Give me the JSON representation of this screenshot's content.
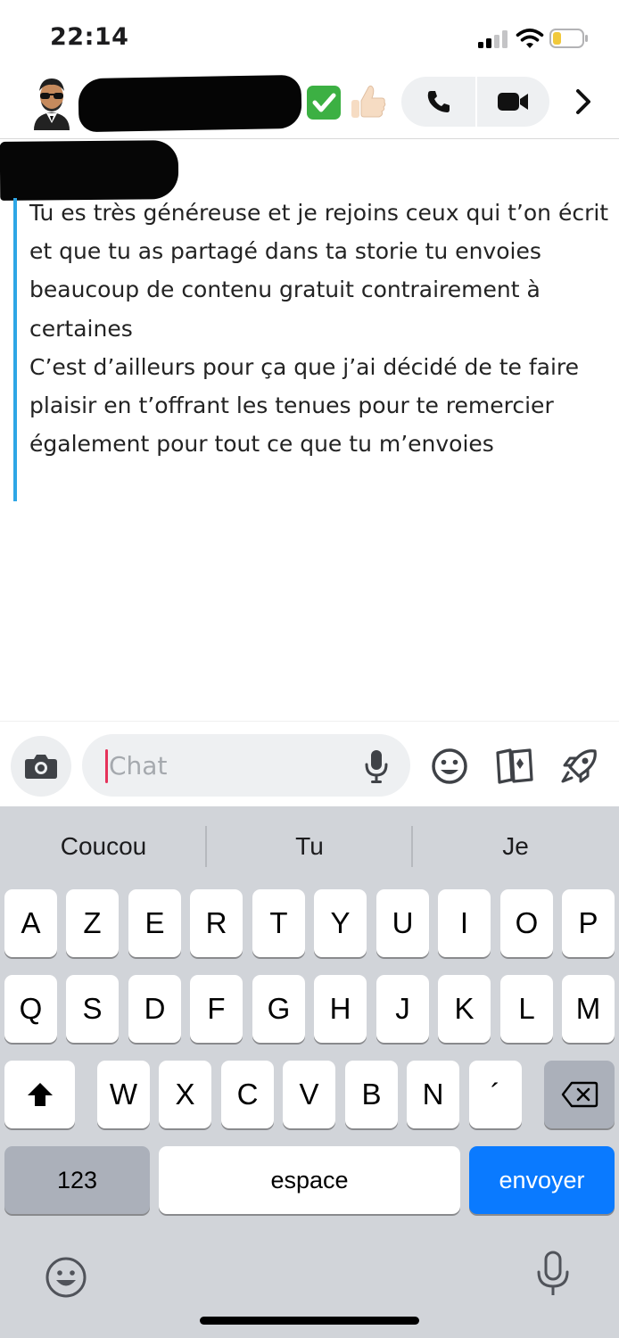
{
  "status_bar": {
    "time": "22:14",
    "signal_bars_active": 2,
    "battery_level": 0.25
  },
  "header": {
    "contact_name": "",
    "status_emojis": [
      "white-check-mark",
      "thumbs-up"
    ],
    "icons": {
      "voice_call": "phone-icon",
      "video_call": "video-camera-icon",
      "more": "chevron-right-icon"
    }
  },
  "message": {
    "sender": "",
    "text": "Tu es très généreuse et je rejoins ceux qui t’on écrit et que tu as partagé dans ta storie tu envoies beaucoup de contenu gratuit contrairement à certaines\nC’est d’ailleurs pour ça que j’ai décidé de te faire plaisir en t’offrant les tenues pour te remercier également pour tout  ce que tu m’envoies",
    "accent_color": "#2ea6e6"
  },
  "chat_bar": {
    "placeholder": "Chat",
    "value": "",
    "icons": [
      "camera-icon",
      "microphone-icon",
      "smiley-icon",
      "cards-icon",
      "rocket-icon"
    ]
  },
  "keyboard": {
    "suggestions": [
      "Coucou",
      "Tu",
      "Je"
    ],
    "row1": [
      "A",
      "Z",
      "E",
      "R",
      "T",
      "Y",
      "U",
      "I",
      "O",
      "P"
    ],
    "row2": [
      "Q",
      "S",
      "D",
      "F",
      "G",
      "H",
      "J",
      "K",
      "L",
      "M"
    ],
    "row3": [
      "W",
      "X",
      "C",
      "V",
      "B",
      "N",
      "´"
    ],
    "numbers_label": "123",
    "space_label": "espace",
    "send_label": "envoyer",
    "send_color": "#0a7aff",
    "icons": [
      "shift-icon",
      "backspace-icon",
      "emoji-icon",
      "dictation-mic-icon"
    ]
  }
}
